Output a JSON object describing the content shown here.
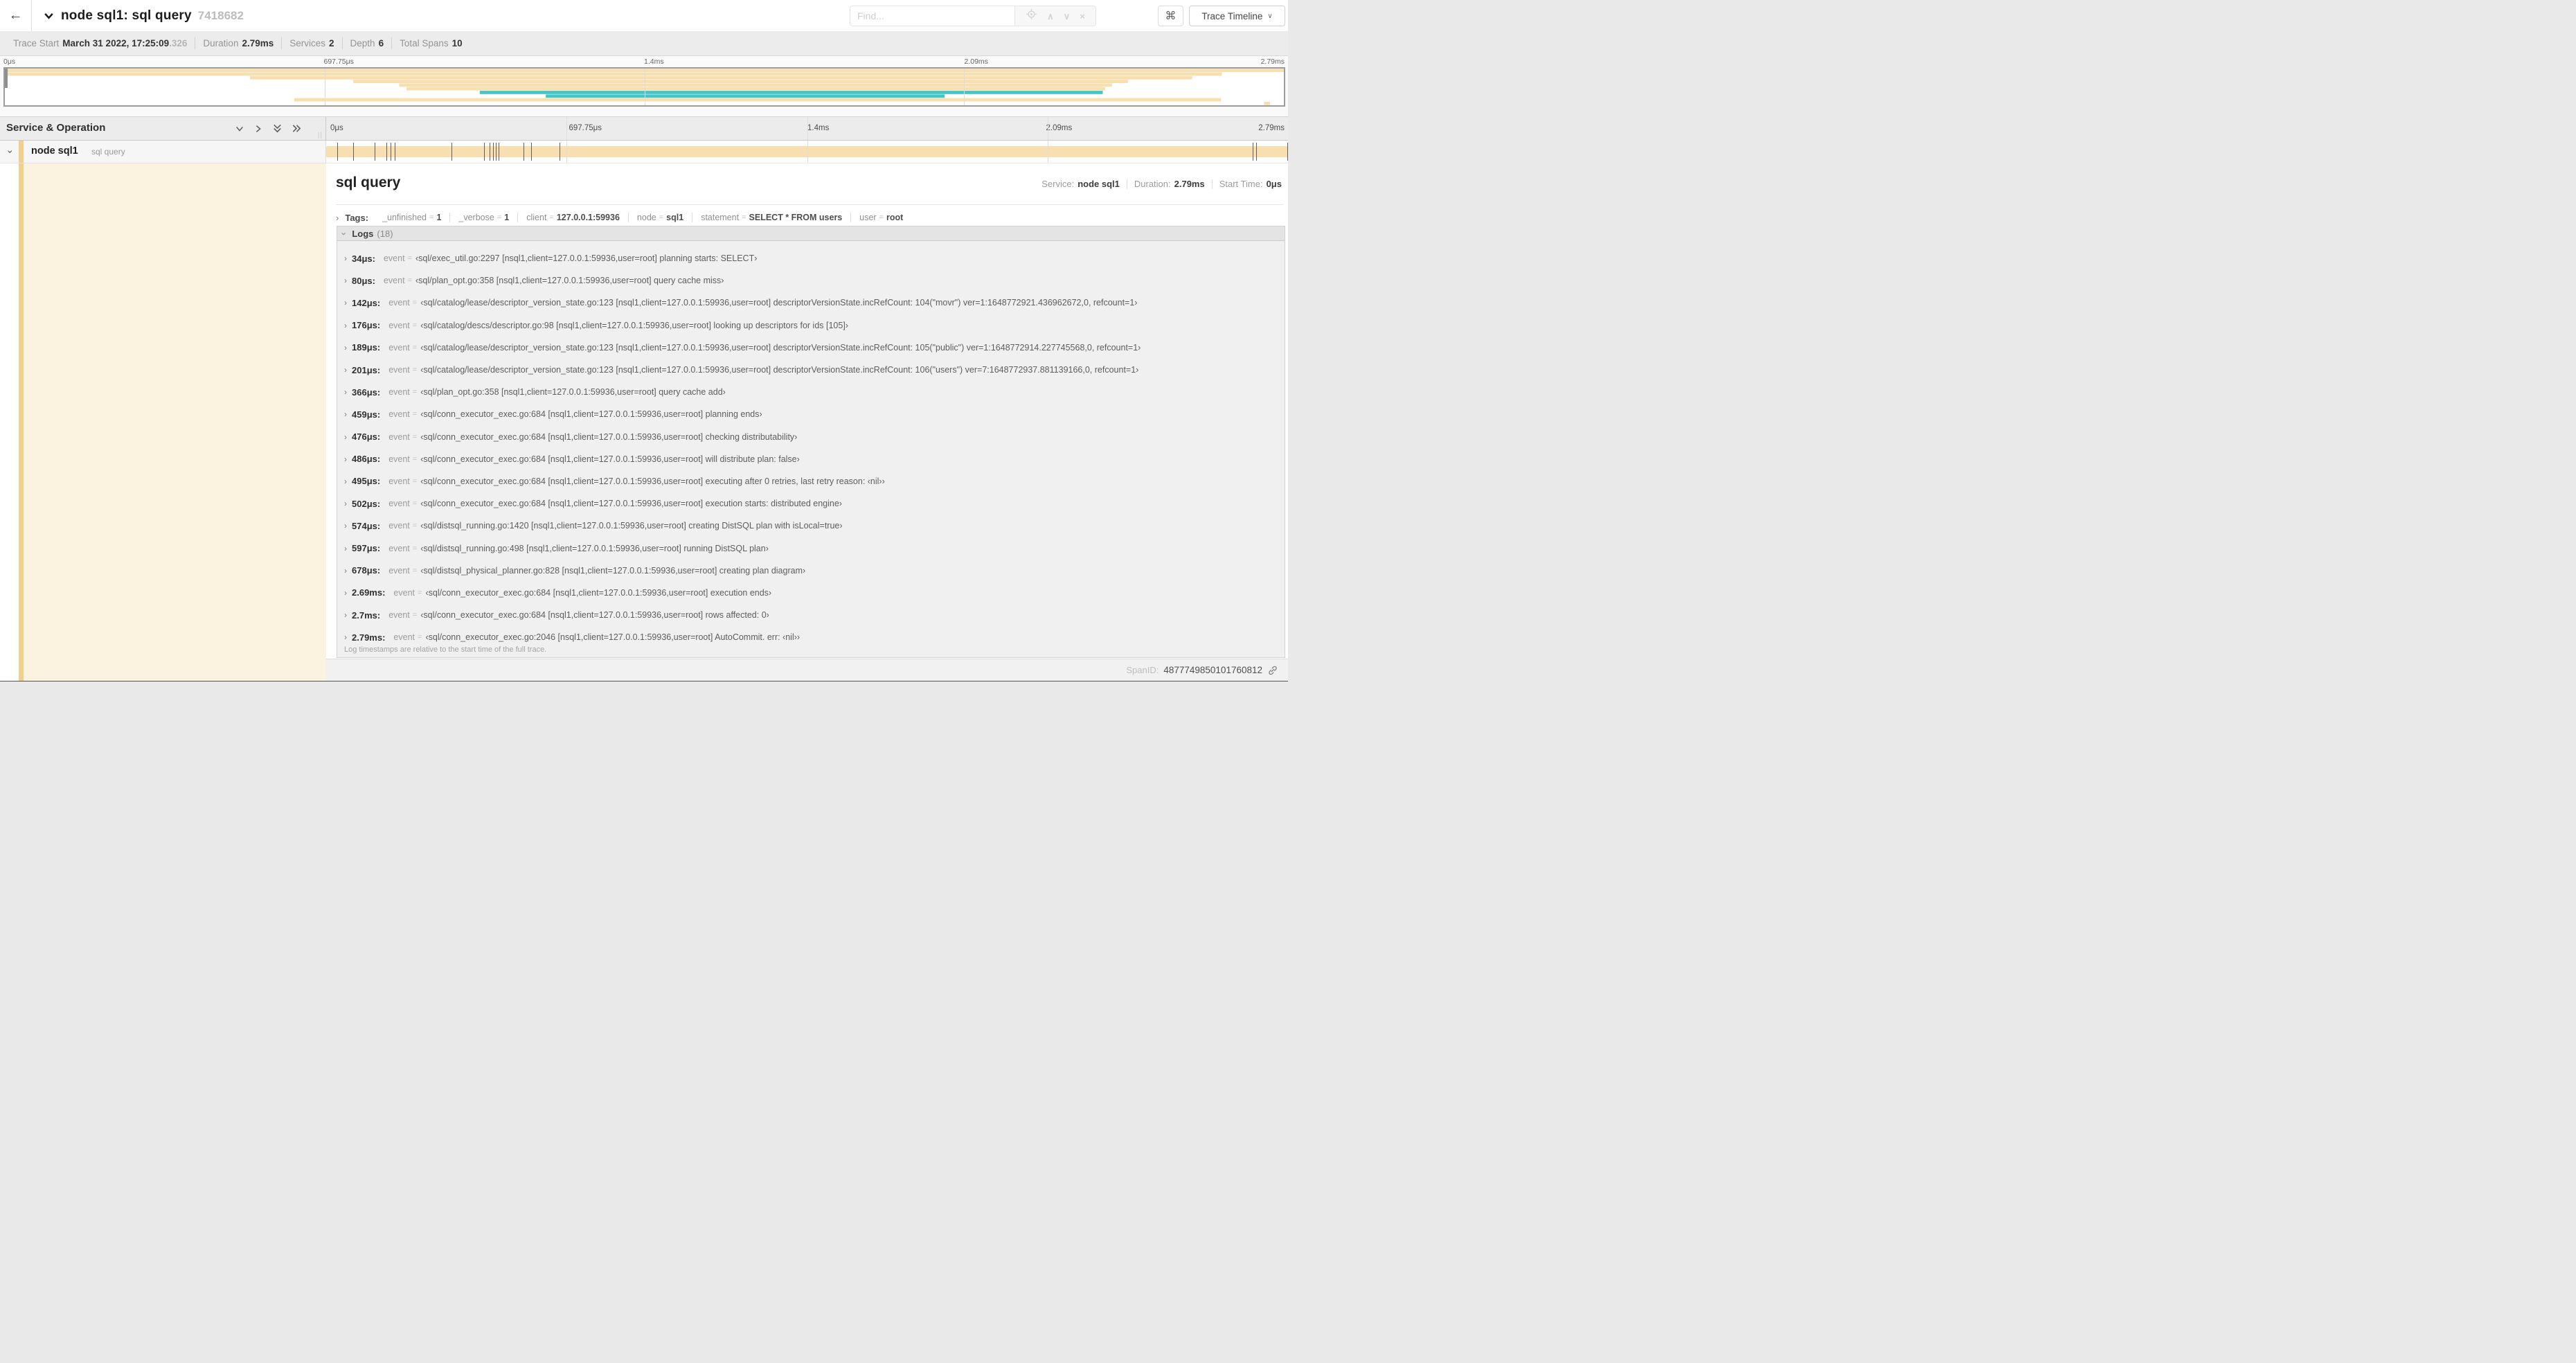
{
  "icons": {
    "back": "←",
    "command": "⌘",
    "close": "×",
    "find_up": "∧",
    "find_down": "∨",
    "dropdown": "∨",
    "expander_right": "›",
    "resizer": "||"
  },
  "header": {
    "title": "node sql1: sql query",
    "trace_id": "7418682",
    "find_placeholder": "Find...",
    "view_label": "Trace Timeline"
  },
  "trace_meta": [
    {
      "label": "Trace Start",
      "value": "March 31 2022, 17:25:09",
      "suffix": ".326"
    },
    {
      "label": "Duration",
      "value": "2.79ms"
    },
    {
      "label": "Services",
      "value": "2"
    },
    {
      "label": "Depth",
      "value": "6"
    },
    {
      "label": "Total Spans",
      "value": "10"
    }
  ],
  "timeline": {
    "column_header": "Service & Operation",
    "row": {
      "service": "node sql1",
      "operation": "sql query"
    }
  },
  "chart_data": {
    "type": "gantt-minimap",
    "total_duration_us": 2790,
    "tick_labels": [
      "0μs",
      "697.75μs",
      "1.4ms",
      "2.09ms",
      "2.79ms"
    ],
    "colors": {
      "tan": "#F8DFB0",
      "teal": "#44C5C8"
    },
    "spans": [
      {
        "start": 0,
        "end": 2790,
        "color": "tan"
      },
      {
        "start": 0,
        "end": 2655,
        "color": "tan"
      },
      {
        "start": 535,
        "end": 2590,
        "color": "tan"
      },
      {
        "start": 760,
        "end": 2450,
        "color": "tan"
      },
      {
        "start": 860,
        "end": 2415,
        "color": "tan"
      },
      {
        "start": 876,
        "end": 2400,
        "color": "tan"
      },
      {
        "start": 1036,
        "end": 2395,
        "color": "teal"
      },
      {
        "start": 1180,
        "end": 2050,
        "color": "teal"
      },
      {
        "start": 631,
        "end": 2653,
        "color": "tan"
      },
      {
        "start": 2747,
        "end": 2760,
        "color": "tan"
      }
    ],
    "selected_span_bar": {
      "start": 0,
      "end": 2790,
      "color": "tan"
    }
  },
  "detail": {
    "title": "sql query",
    "service_label": "Service:",
    "service": "node sql1",
    "duration_label": "Duration:",
    "duration": "2.79ms",
    "start_label": "Start Time:",
    "start": "0μs",
    "tags_label": "Tags:",
    "tags": [
      {
        "key": "_unfinished",
        "value": "1"
      },
      {
        "key": "_verbose",
        "value": "1"
      },
      {
        "key": "client",
        "value": "127.0.0.1:59936"
      },
      {
        "key": "node",
        "value": "sql1"
      },
      {
        "key": "statement",
        "value": "SELECT * FROM users"
      },
      {
        "key": "user",
        "value": "root"
      }
    ],
    "logs_label": "Logs",
    "logs_count": "(18)",
    "logs": [
      {
        "time": "34μs:",
        "time_us": 34,
        "key": "event",
        "value": "‹sql/exec_util.go:2297 [nsql1,client=127.0.0.1:59936,user=root] planning starts: SELECT›"
      },
      {
        "time": "80μs:",
        "time_us": 80,
        "key": "event",
        "value": "‹sql/plan_opt.go:358 [nsql1,client=127.0.0.1:59936,user=root] query cache miss›"
      },
      {
        "time": "142μs:",
        "time_us": 142,
        "key": "event",
        "value": "‹sql/catalog/lease/descriptor_version_state.go:123 [nsql1,client=127.0.0.1:59936,user=root] descriptorVersionState.incRefCount: 104(\"movr\") ver=1:1648772921.436962672,0, refcount=1›"
      },
      {
        "time": "176μs:",
        "time_us": 176,
        "key": "event",
        "value": "‹sql/catalog/descs/descriptor.go:98 [nsql1,client=127.0.0.1:59936,user=root] looking up descriptors for ids [105]›"
      },
      {
        "time": "189μs:",
        "time_us": 189,
        "key": "event",
        "value": "‹sql/catalog/lease/descriptor_version_state.go:123 [nsql1,client=127.0.0.1:59936,user=root] descriptorVersionState.incRefCount: 105(\"public\") ver=1:1648772914.227745568,0, refcount=1›"
      },
      {
        "time": "201μs:",
        "time_us": 201,
        "key": "event",
        "value": "‹sql/catalog/lease/descriptor_version_state.go:123 [nsql1,client=127.0.0.1:59936,user=root] descriptorVersionState.incRefCount: 106(\"users\") ver=7:1648772937.881139166,0, refcount=1›"
      },
      {
        "time": "366μs:",
        "time_us": 366,
        "key": "event",
        "value": "‹sql/plan_opt.go:358 [nsql1,client=127.0.0.1:59936,user=root] query cache add›"
      },
      {
        "time": "459μs:",
        "time_us": 459,
        "key": "event",
        "value": "‹sql/conn_executor_exec.go:684 [nsql1,client=127.0.0.1:59936,user=root] planning ends›"
      },
      {
        "time": "476μs:",
        "time_us": 476,
        "key": "event",
        "value": "‹sql/conn_executor_exec.go:684 [nsql1,client=127.0.0.1:59936,user=root] checking distributability›"
      },
      {
        "time": "486μs:",
        "time_us": 486,
        "key": "event",
        "value": "‹sql/conn_executor_exec.go:684 [nsql1,client=127.0.0.1:59936,user=root] will distribute plan: false›"
      },
      {
        "time": "495μs:",
        "time_us": 495,
        "key": "event",
        "value": "‹sql/conn_executor_exec.go:684 [nsql1,client=127.0.0.1:59936,user=root] executing after 0 retries, last retry reason: ‹nil››"
      },
      {
        "time": "502μs:",
        "time_us": 502,
        "key": "event",
        "value": "‹sql/conn_executor_exec.go:684 [nsql1,client=127.0.0.1:59936,user=root] execution starts: distributed engine›"
      },
      {
        "time": "574μs:",
        "time_us": 574,
        "key": "event",
        "value": "‹sql/distsql_running.go:1420 [nsql1,client=127.0.0.1:59936,user=root] creating DistSQL plan with isLocal=true›"
      },
      {
        "time": "597μs:",
        "time_us": 597,
        "key": "event",
        "value": "‹sql/distsql_running.go:498 [nsql1,client=127.0.0.1:59936,user=root] running DistSQL plan›"
      },
      {
        "time": "678μs:",
        "time_us": 678,
        "key": "event",
        "value": "‹sql/distsql_physical_planner.go:828 [nsql1,client=127.0.0.1:59936,user=root] creating plan diagram›"
      },
      {
        "time": "2.69ms:",
        "time_us": 2690,
        "key": "event",
        "value": "‹sql/conn_executor_exec.go:684 [nsql1,client=127.0.0.1:59936,user=root] execution ends›"
      },
      {
        "time": "2.7ms:",
        "time_us": 2700,
        "key": "event",
        "value": "‹sql/conn_executor_exec.go:684 [nsql1,client=127.0.0.1:59936,user=root] rows affected: 0›"
      },
      {
        "time": "2.79ms:",
        "time_us": 2790,
        "key": "event",
        "value": "‹sql/conn_executor_exec.go:2046 [nsql1,client=127.0.0.1:59936,user=root] AutoCommit. err: ‹nil››"
      }
    ],
    "logs_footnote": "Log timestamps are relative to the start time of the full trace."
  },
  "footer": {
    "span_id_label": "SpanID:",
    "span_id": "4877749850101760812"
  }
}
